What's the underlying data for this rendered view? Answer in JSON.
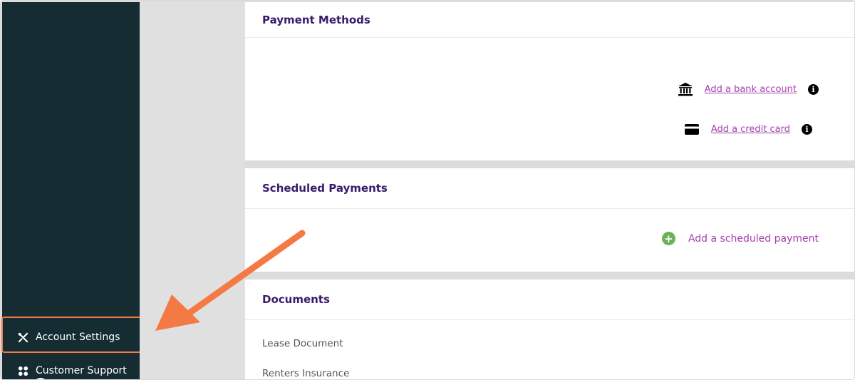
{
  "sidebar": {
    "items": [
      {
        "label": "Account Settings",
        "icon": "tools-icon"
      },
      {
        "label": "Customer Support",
        "icon": "support-icon"
      }
    ]
  },
  "payment_methods": {
    "title": "Payment Methods",
    "bank_link": "Add a bank account",
    "card_link": "Add a credit card",
    "info_glyph": "i"
  },
  "scheduled_payments": {
    "title": "Scheduled Payments",
    "add_label": "Add a scheduled payment"
  },
  "documents": {
    "title": "Documents",
    "items": [
      "Lease Document",
      "Renters Insurance"
    ]
  },
  "colors": {
    "sidebar_bg": "#162c33",
    "accent_purple": "#a63fb0",
    "heading": "#3a1a6b",
    "highlight": "#f47a45",
    "add_green": "#6bb25a"
  }
}
